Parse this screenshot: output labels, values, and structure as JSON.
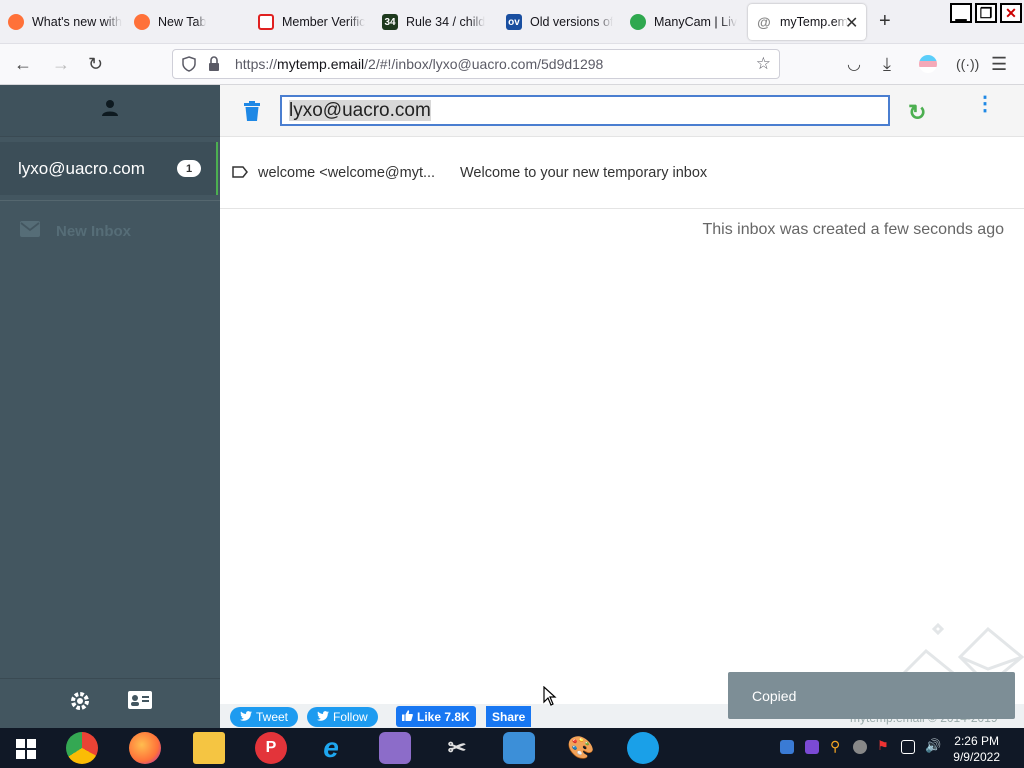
{
  "browser": {
    "tabs": [
      {
        "label": "What's new with",
        "icon": "firefox-icon",
        "color": "#ff7139"
      },
      {
        "label": "New Tab",
        "icon": "firefox-icon",
        "color": "#ff7139"
      },
      {
        "label": "Member Verific",
        "icon": "video-icon",
        "color": "#e02020"
      },
      {
        "label": "Rule 34 / child",
        "icon": "rule34-icon",
        "color": "#1e3a1e"
      },
      {
        "label": "Old versions of",
        "icon": "ov-icon",
        "color": "#1a4fa0"
      },
      {
        "label": "ManyCam | Liv",
        "icon": "manycam-icon",
        "color": "#2fa84f"
      },
      {
        "label": "myTemp.em",
        "icon": "at-icon",
        "color": "#888888"
      }
    ],
    "url_prefix": "https://",
    "url_domain": "mytemp.email",
    "url_path": "/2/#!/inbox/lyxo@uacro.com/5d9d1298"
  },
  "sidebar": {
    "active_inbox": "lyxo@uacro.com",
    "active_count": "1",
    "new_inbox_label": "New Inbox"
  },
  "main": {
    "email_address": "lyxo@uacro.com",
    "messages": [
      {
        "from": "welcome <welcome@myt...",
        "subject": "Welcome to your new temporary inbox"
      }
    ],
    "created_text": "This inbox was created a few seconds ago"
  },
  "footer": {
    "tweet": "Tweet",
    "follow": "Follow",
    "like": "Like 7.8K",
    "share": "Share",
    "copyright": "mytemp.email © 2014-2019"
  },
  "toast": {
    "text": "Copied"
  },
  "taskbar": {
    "time": "2:26 PM",
    "date": "9/9/2022"
  },
  "colors": {
    "sidebar_bg": "#435660",
    "accent_blue": "#1e88e5",
    "refresh_green": "#4caf50"
  }
}
